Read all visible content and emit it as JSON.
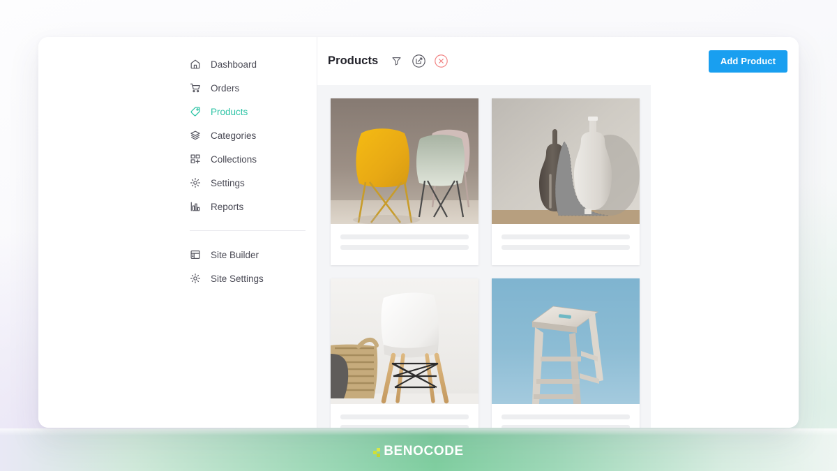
{
  "brand": {
    "name": "BENOCODE",
    "mark_color": "#cfe038",
    "band_color": "#80cea0"
  },
  "sidebar": {
    "items": [
      {
        "label": "Dashboard",
        "icon": "home-icon",
        "active": false
      },
      {
        "label": "Orders",
        "icon": "cart-icon",
        "active": false
      },
      {
        "label": "Products",
        "icon": "tag-icon",
        "active": true
      },
      {
        "label": "Categories",
        "icon": "layers-icon",
        "active": false
      },
      {
        "label": "Collections",
        "icon": "grid-plus-icon",
        "active": false
      },
      {
        "label": "Settings",
        "icon": "gear-icon",
        "active": false
      },
      {
        "label": "Reports",
        "icon": "bar-chart-icon",
        "active": false
      }
    ],
    "secondary_items": [
      {
        "label": "Site Builder",
        "icon": "layout-icon"
      },
      {
        "label": "Site Settings",
        "icon": "gear-icon"
      }
    ],
    "active_color": "#2ec4a6",
    "text_color": "#4a4a55"
  },
  "header": {
    "title": "Products",
    "tools": [
      {
        "name": "filter-icon",
        "title": "Filter"
      },
      {
        "name": "bulk-edit-icon",
        "title": "Bulk edit"
      },
      {
        "name": "delete-icon",
        "title": "Delete"
      }
    ],
    "primary_action": {
      "label": "Add Product",
      "color": "#199ff0"
    }
  },
  "grid": {
    "products": [
      {
        "image": "yellow-and-sage-chairs",
        "alt": "Yellow molded chair with sage green and pink chairs on warm grey backdrop",
        "loading": true
      },
      {
        "image": "ceramic-vases-still-life",
        "alt": "Dark brown bottle vase and white bottle vase with grey knit fabric",
        "loading": true
      },
      {
        "image": "white-eames-chair",
        "alt": "White shell chair with wooden legs beside woven basket",
        "loading": true
      },
      {
        "image": "wooden-bar-stool",
        "alt": "Whitewashed wooden bar stool on blue background",
        "loading": true
      }
    ],
    "background": "#f4f5f7"
  }
}
